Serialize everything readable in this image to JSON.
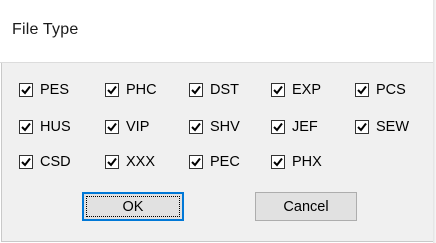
{
  "dialog": {
    "title": "File Type"
  },
  "checkboxes": [
    {
      "label": "PES",
      "checked": true
    },
    {
      "label": "PHC",
      "checked": true
    },
    {
      "label": "DST",
      "checked": true
    },
    {
      "label": "EXP",
      "checked": true
    },
    {
      "label": "PCS",
      "checked": true
    },
    {
      "label": "HUS",
      "checked": true
    },
    {
      "label": "VIP",
      "checked": true
    },
    {
      "label": "SHV",
      "checked": true
    },
    {
      "label": "JEF",
      "checked": true
    },
    {
      "label": "SEW",
      "checked": true
    },
    {
      "label": "CSD",
      "checked": true
    },
    {
      "label": "XXX",
      "checked": true
    },
    {
      "label": "PEC",
      "checked": true
    },
    {
      "label": "PHX",
      "checked": true
    }
  ],
  "buttons": {
    "ok_label": "OK",
    "cancel_label": "Cancel"
  }
}
